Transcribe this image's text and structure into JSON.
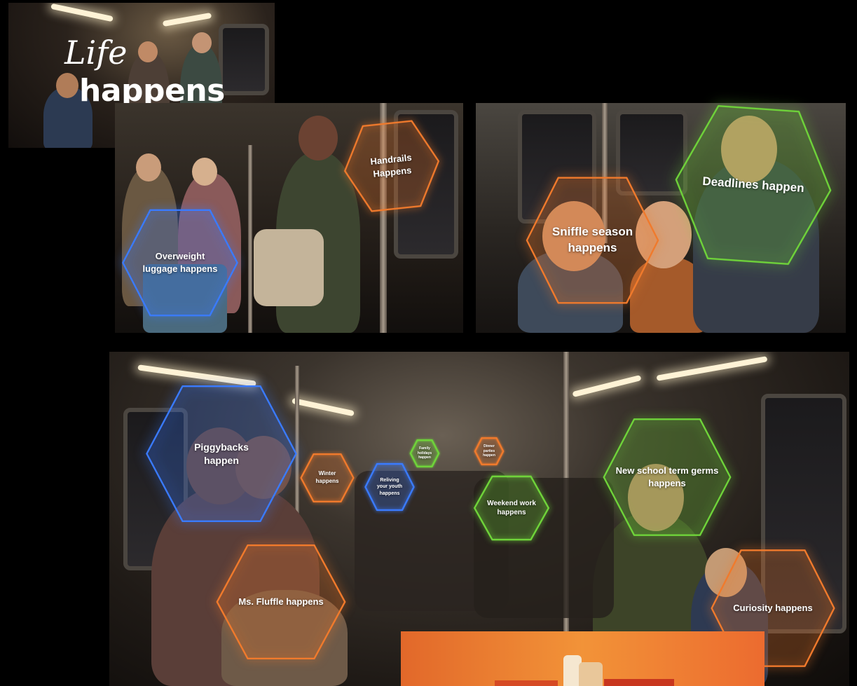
{
  "title": {
    "script": "Life",
    "main": "happens"
  },
  "hexagons": [
    {
      "text": "Handrails\nHappens",
      "color": "#f07a2c"
    },
    {
      "text": "Overweight\nluggage happens",
      "color": "#3a7bff"
    },
    {
      "text": "Sniffle season\nhappens",
      "color": "#f07a2c"
    },
    {
      "text": "Deadlines happen",
      "color": "#6fd43a"
    },
    {
      "text": "Piggybacks\nhappen",
      "color": "#3a7bff"
    },
    {
      "text": "Winter\nhappens",
      "color": "#f07a2c"
    },
    {
      "text": "Reliving\nyour youth\nhappens",
      "color": "#3a7bff"
    },
    {
      "text": "Family\nholidays\nhappen",
      "color": "#6fd43a"
    },
    {
      "text": "Dinner\nparties\nhappen",
      "color": "#f07a2c"
    },
    {
      "text": "Weekend work\nhappens",
      "color": "#6fd43a"
    },
    {
      "text": "New school term germs\nhappens",
      "color": "#6fd43a"
    },
    {
      "text": "Ms. Fluffle happens",
      "color": "#f07a2c"
    },
    {
      "text": "Curiosity happens",
      "color": "#f07a2c"
    }
  ],
  "colors": {
    "orange": "#f07a2c",
    "blue": "#3a7bff",
    "green": "#6fd43a",
    "promo": "#f29338"
  }
}
